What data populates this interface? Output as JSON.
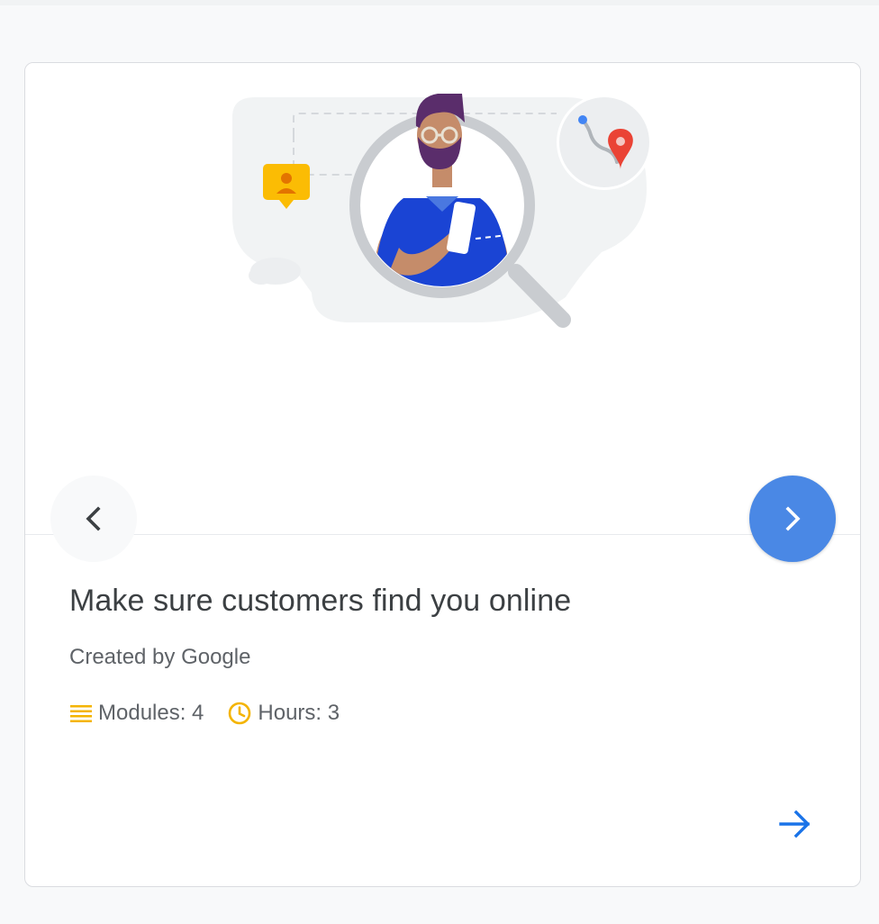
{
  "course": {
    "title": "Make sure customers find you online",
    "creator": "Created by Google",
    "modules_label": "Modules: 4",
    "hours_label": "Hours: 3"
  },
  "illustration": {
    "description_icon": "illustration-man-with-phone-in-magnifier"
  },
  "navigation": {
    "prev_icon": "chevron-left-icon",
    "next_icon": "chevron-right-icon",
    "go_icon": "arrow-right-icon"
  },
  "colors": {
    "accent_blue": "#4a88e5",
    "link_blue": "#1a73e8",
    "meta_icon": "#f4b400",
    "title_text": "#3c4043",
    "secondary_text": "#5f6368"
  }
}
